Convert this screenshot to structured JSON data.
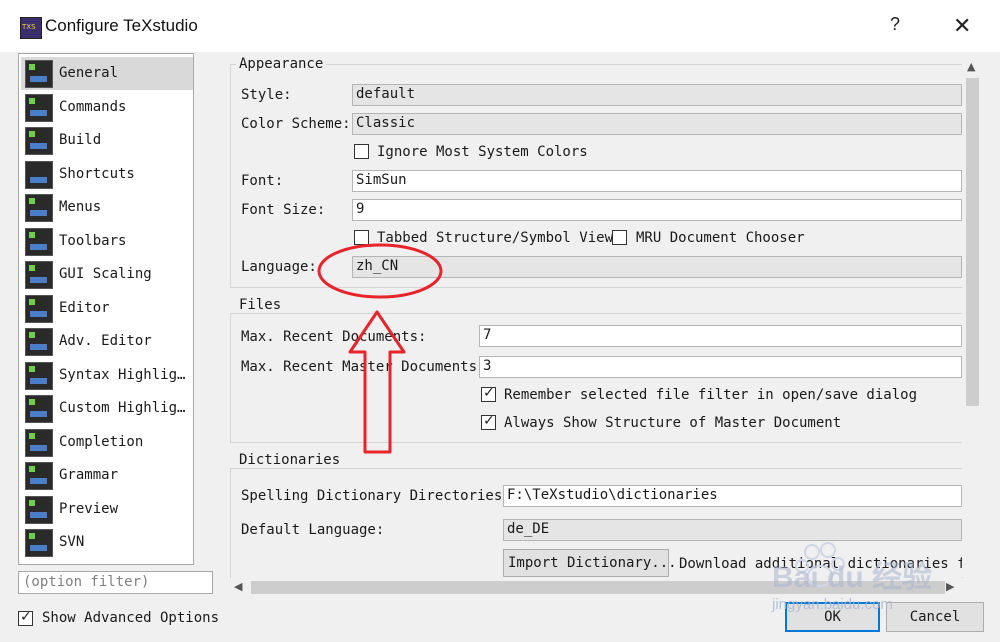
{
  "window": {
    "title": "Configure TeXstudio",
    "help": "?",
    "close": "✕"
  },
  "sidebar": {
    "items": [
      {
        "label": "General",
        "icon": "general-icon"
      },
      {
        "label": "Commands",
        "icon": "commands-icon"
      },
      {
        "label": "Build",
        "icon": "build-icon"
      },
      {
        "label": "Shortcuts",
        "icon": "shortcuts-icon"
      },
      {
        "label": "Menus",
        "icon": "menus-icon"
      },
      {
        "label": "Toolbars",
        "icon": "toolbars-icon"
      },
      {
        "label": "GUI Scaling",
        "icon": "gui-scaling-icon"
      },
      {
        "label": "Editor",
        "icon": "editor-icon"
      },
      {
        "label": "Adv. Editor",
        "icon": "adv-editor-icon"
      },
      {
        "label": "Syntax Highlig…",
        "icon": "syntax-highlighting-icon"
      },
      {
        "label": "Custom Highlig…",
        "icon": "custom-highlighting-icon"
      },
      {
        "label": "Completion",
        "icon": "completion-icon"
      },
      {
        "label": "Grammar",
        "icon": "grammar-icon"
      },
      {
        "label": "Preview",
        "icon": "preview-icon"
      },
      {
        "label": "SVN",
        "icon": "svn-icon"
      }
    ],
    "selected": "General"
  },
  "filter": {
    "placeholder": "(option filter)"
  },
  "show_advanced": {
    "label": "Show Advanced Options",
    "checked": true
  },
  "appearance": {
    "title": "Appearance",
    "style_label": "Style:",
    "style_value": "default",
    "scheme_label": "Color Scheme:",
    "scheme_value": "Classic",
    "ignore_colors_label": "Ignore Most System Colors",
    "ignore_colors_checked": false,
    "font_label": "Font:",
    "font_value": "SimSun",
    "font_size_label": "Font Size:",
    "font_size_value": "9",
    "tabbed_label": "Tabbed Structure/Symbol View",
    "tabbed_checked": false,
    "mru_label": "MRU Document Chooser",
    "mru_checked": false,
    "language_label": "Language:",
    "language_value": "zh_CN"
  },
  "files": {
    "title": "Files",
    "recent_docs_label": "Max. Recent Documents:",
    "recent_docs_value": "7",
    "recent_master_label": "Max. Recent Master Documents:",
    "recent_master_value": "3",
    "remember_filter_label": "Remember selected file filter in open/save dialog",
    "remember_filter_checked": true,
    "show_structure_label": "Always Show Structure of Master Document",
    "show_structure_checked": true
  },
  "dictionaries": {
    "title": "Dictionaries",
    "dirs_label": "Spelling Dictionary Directories:",
    "dirs_value": "F:\\TeXstudio\\dictionaries",
    "default_lang_label": "Default Language:",
    "default_lang_value": "de_DE",
    "import_button": "Import Dictionary...",
    "download_link": "Download additional dictionaries fro"
  },
  "buttons": {
    "ok": "OK",
    "cancel": "Cancel"
  },
  "annotation_color": "#e8232a",
  "watermark": {
    "brand": "Bai du 经验",
    "url": "jingyan.baidu.com"
  }
}
